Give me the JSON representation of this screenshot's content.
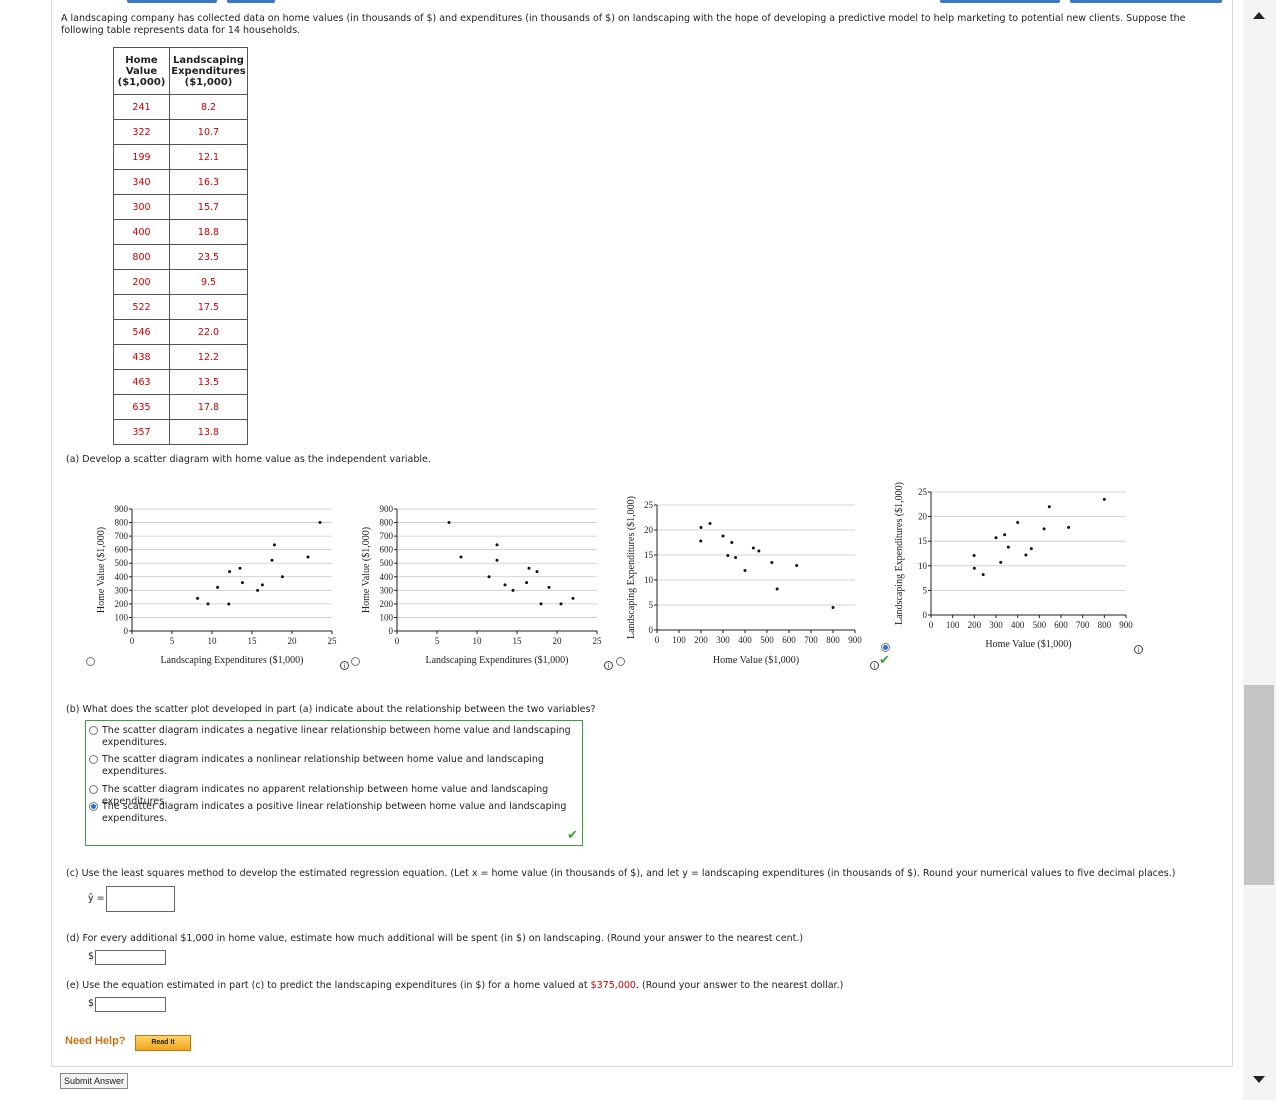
{
  "intro": "A landscaping company has collected data on home values (in thousands of $) and expenditures (in thousands of $) on landscaping with the hope of developing a predictive model to help marketing to potential new clients. Suppose the following table represents data for 14 households.",
  "table": {
    "headers": [
      "Home Value ($1,000)",
      "Landscaping Expenditures ($1,000)"
    ],
    "rows": [
      [
        "241",
        "8.2"
      ],
      [
        "322",
        "10.7"
      ],
      [
        "199",
        "12.1"
      ],
      [
        "340",
        "16.3"
      ],
      [
        "300",
        "15.7"
      ],
      [
        "400",
        "18.8"
      ],
      [
        "800",
        "23.5"
      ],
      [
        "200",
        "9.5"
      ],
      [
        "522",
        "17.5"
      ],
      [
        "546",
        "22.0"
      ],
      [
        "438",
        "12.2"
      ],
      [
        "463",
        "13.5"
      ],
      [
        "635",
        "17.8"
      ],
      [
        "357",
        "13.8"
      ]
    ]
  },
  "part_a": {
    "prompt": "(a)  Develop a scatter diagram with home value as the independent variable."
  },
  "charts": [
    {
      "xlabel": "Landscaping Expenditures ($1,000)",
      "ylabel": "Home Value ($1,000)",
      "xticks": [
        "0",
        "5",
        "10",
        "15",
        "20",
        "25"
      ],
      "yticks": [
        "0",
        "100",
        "200",
        "300",
        "400",
        "500",
        "600",
        "700",
        "800",
        "900"
      ],
      "selected": false
    },
    {
      "xlabel": "Landscaping Expenditures ($1,000)",
      "ylabel": "Home Value ($1,000)",
      "xticks": [
        "0",
        "5",
        "10",
        "15",
        "20",
        "25"
      ],
      "yticks": [
        "0",
        "100",
        "200",
        "300",
        "400",
        "500",
        "600",
        "700",
        "800",
        "900"
      ],
      "selected": false
    },
    {
      "xlabel": "Home Value ($1,000)",
      "ylabel": "Landscaping Expenditures ($1,000)",
      "xticks": [
        "0",
        "100",
        "200",
        "300",
        "400",
        "500",
        "600",
        "700",
        "800",
        "900"
      ],
      "yticks": [
        "0",
        "5",
        "10",
        "15",
        "20",
        "25"
      ],
      "selected": false
    },
    {
      "xlabel": "Home Value ($1,000)",
      "ylabel": "Landscaping Expenditures ($1,000)",
      "xticks": [
        "0",
        "100",
        "200",
        "300",
        "400",
        "500",
        "600",
        "700",
        "800",
        "900"
      ],
      "yticks": [
        "0",
        "5",
        "10",
        "15",
        "20",
        "25"
      ],
      "selected": true
    }
  ],
  "chart_data": [
    {
      "type": "scatter",
      "xlabel": "Landscaping Expenditures ($1,000)",
      "ylabel": "Home Value ($1,000)",
      "xlim": [
        0,
        25
      ],
      "ylim": [
        0,
        900
      ],
      "grid": true,
      "points": [
        [
          8.2,
          241
        ],
        [
          9.5,
          200
        ],
        [
          10.7,
          322
        ],
        [
          12.1,
          199
        ],
        [
          12.2,
          438
        ],
        [
          13.5,
          463
        ],
        [
          13.8,
          357
        ],
        [
          15.7,
          300
        ],
        [
          16.3,
          340
        ],
        [
          17.5,
          522
        ],
        [
          17.8,
          635
        ],
        [
          18.8,
          400
        ],
        [
          22.0,
          546
        ],
        [
          23.5,
          800
        ]
      ]
    },
    {
      "type": "scatter",
      "xlabel": "Landscaping Expenditures ($1,000)",
      "ylabel": "Home Value ($1,000)",
      "xlim": [
        0,
        25
      ],
      "ylim": [
        0,
        900
      ],
      "grid": true,
      "points": [
        [
          6.5,
          800
        ],
        [
          8,
          546
        ],
        [
          11.5,
          400
        ],
        [
          12.5,
          522
        ],
        [
          12.5,
          635
        ],
        [
          13.5,
          340
        ],
        [
          14.5,
          300
        ],
        [
          16.2,
          357
        ],
        [
          16.5,
          463
        ],
        [
          17.5,
          438
        ],
        [
          18,
          200
        ],
        [
          19,
          322
        ],
        [
          20.5,
          200
        ],
        [
          22,
          241
        ]
      ]
    },
    {
      "type": "scatter",
      "xlabel": "Home Value ($1,000)",
      "ylabel": "Landscaping Expenditures ($1,000)",
      "xlim": [
        0,
        900
      ],
      "ylim": [
        0,
        25
      ],
      "grid": true,
      "points": [
        [
          199,
          17.8
        ],
        [
          200,
          20.5
        ],
        [
          241,
          21.3
        ],
        [
          300,
          18.8
        ],
        [
          322,
          14.9
        ],
        [
          340,
          17.5
        ],
        [
          357,
          14.5
        ],
        [
          400,
          11.9
        ],
        [
          438,
          16.4
        ],
        [
          463,
          15.8
        ],
        [
          522,
          13.5
        ],
        [
          546,
          8.2
        ],
        [
          635,
          12.9
        ],
        [
          800,
          4.5
        ]
      ]
    },
    {
      "type": "scatter",
      "xlabel": "Home Value ($1,000)",
      "ylabel": "Landscaping Expenditures ($1,000)",
      "xlim": [
        0,
        900
      ],
      "ylim": [
        0,
        25
      ],
      "grid": true,
      "points": [
        [
          241,
          8.2
        ],
        [
          322,
          10.7
        ],
        [
          199,
          12.1
        ],
        [
          340,
          16.3
        ],
        [
          300,
          15.7
        ],
        [
          400,
          18.8
        ],
        [
          800,
          23.5
        ],
        [
          200,
          9.5
        ],
        [
          522,
          17.5
        ],
        [
          546,
          22.0
        ],
        [
          438,
          12.2
        ],
        [
          463,
          13.5
        ],
        [
          635,
          17.8
        ],
        [
          357,
          13.8
        ]
      ]
    }
  ],
  "part_b": {
    "prompt": "(b)  What does the scatter plot developed in part (a) indicate about the relationship between the two variables?",
    "options": [
      "The scatter diagram indicates a negative linear relationship between home value and landscaping expenditures.",
      "The scatter diagram indicates a nonlinear relationship between home value and landscaping expenditures.",
      "The scatter diagram indicates no apparent relationship between home value and landscaping expenditures.",
      "The scatter diagram indicates a positive linear relationship between home value and landscaping expenditures."
    ],
    "selected_index": 3
  },
  "part_c": {
    "prompt": "(c)  Use the least squares method to develop the estimated regression equation. (Let x = home value (in thousands of $), and let y = landscaping expenditures (in thousands of $). Round your numerical values to five decimal places.)",
    "label": "ŷ =",
    "value": ""
  },
  "part_d": {
    "prompt": "(d)  For every additional $1,000 in home value, estimate how much additional will be spent (in $) on landscaping. (Round your answer to the nearest cent.)",
    "currency": "$",
    "value": ""
  },
  "part_e": {
    "prompt_before": "(e)  Use the equation estimated in part (c) to predict the landscaping expenditures (in $) for a home valued at ",
    "highlight": "$375,000",
    "prompt_after": ". (Round your answer to the nearest dollar.)",
    "currency": "$",
    "value": ""
  },
  "help": {
    "label": "Need Help?",
    "read_it": "Read It"
  },
  "submit_label": "Submit Answer",
  "colors": {
    "answer_red": "#cc0000",
    "correct_green": "#3aa13a",
    "radio_blue": "#2b6fd1",
    "help_orange": "#c87214"
  }
}
